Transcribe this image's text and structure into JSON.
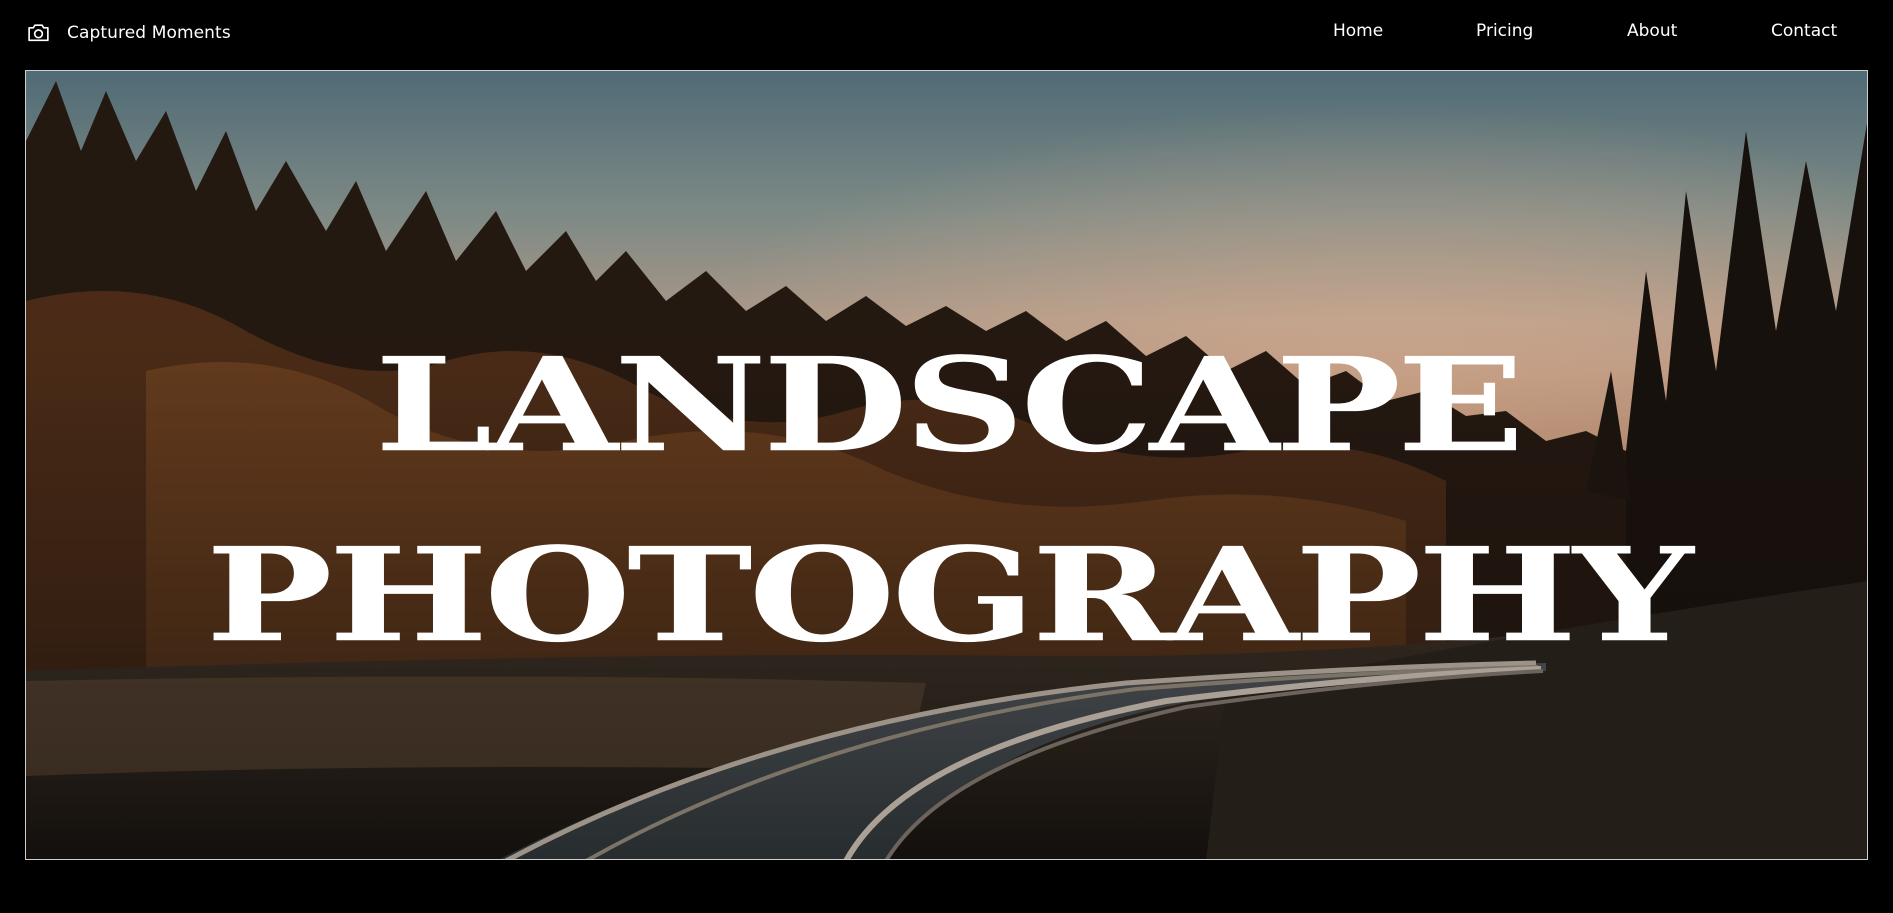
{
  "brand": {
    "name": "Captured Moments",
    "icon": "camera-icon"
  },
  "nav": {
    "items": [
      {
        "label": "Home"
      },
      {
        "label": "Pricing"
      },
      {
        "label": "About"
      },
      {
        "label": "Contact"
      }
    ]
  },
  "hero": {
    "title_line_1": "LANDSCAPE",
    "title_line_2": "PHOTOGRAPHY",
    "image_subject": "curved railway track through autumn forest at sunset"
  },
  "colors": {
    "background": "#000000",
    "text": "#ffffff",
    "hero_border": "#cfcfcf"
  }
}
